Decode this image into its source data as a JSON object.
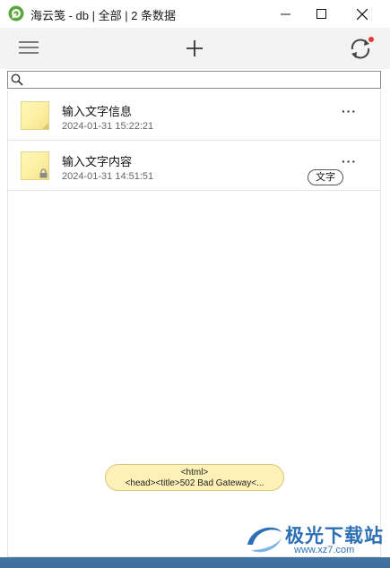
{
  "window": {
    "title": "海云笺 - db | 全部 | 2 条数据",
    "controls": {
      "minimize": "—",
      "maximize": "☐",
      "close": "✕"
    }
  },
  "toolbar": {
    "menu_icon": "hamburger-menu-icon",
    "add_icon": "plus-icon",
    "sync_icon": "sync-icon",
    "sync_badge_color": "#e53935"
  },
  "search": {
    "value": "",
    "placeholder": ""
  },
  "notes": [
    {
      "title": "输入文字信息",
      "date": "2024-01-31 15:22:21",
      "locked": false,
      "tag": ""
    },
    {
      "title": "输入文字内容",
      "date": "2024-01-31 14:51:51",
      "locked": true,
      "tag": "文字"
    }
  ],
  "more_label": "···",
  "toast": {
    "line1": "<html>",
    "line2": "<head><title>502 Bad Gateway<..."
  },
  "watermark": {
    "name": "极光下载站",
    "url": "www.xz7.com"
  },
  "colors": {
    "accent": "#2d6fb4",
    "note_yellow": "#fdeea0",
    "toast_bg": "#fdf1b8"
  }
}
